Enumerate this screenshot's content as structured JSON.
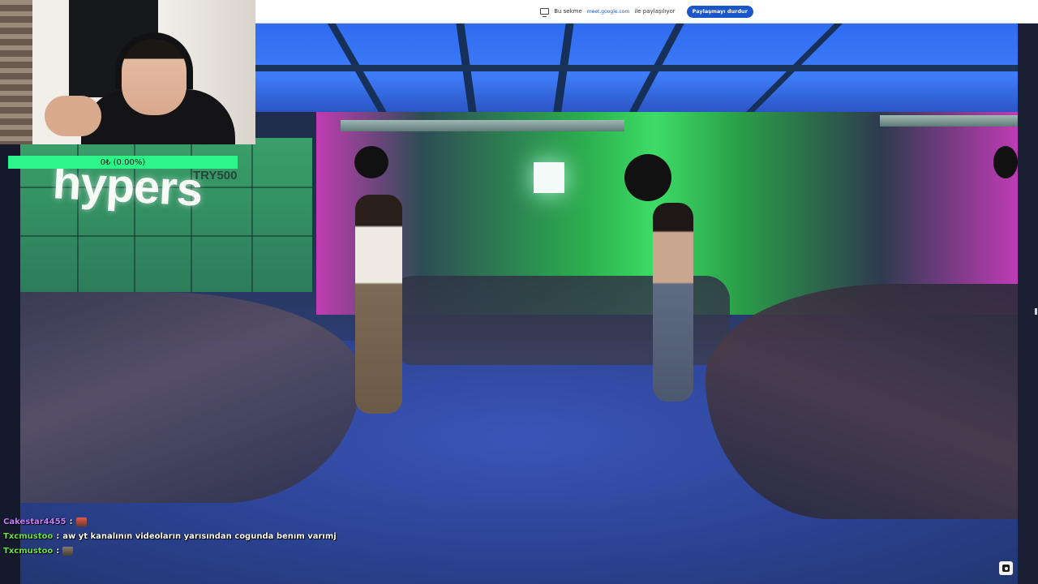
{
  "share_bar": {
    "prefix": "Bu sekme",
    "domain": "meet.google.com",
    "suffix": "ile paylaşılıyor",
    "stop_button": "Paylaşmayı durdur"
  },
  "overlay": {
    "goal_text": "0₺ (0.00%)",
    "brand_sign": "hypers",
    "sign_label": "TRY500"
  },
  "chat": {
    "messages": [
      {
        "user": "Cakestar4455",
        "separator": ":",
        "text": "",
        "emote": "emote"
      },
      {
        "user": "Txcmustoo",
        "separator": ":",
        "text": "aw yt kanalının videoların yarısından cogunda benım varımj",
        "emote": ""
      },
      {
        "user": "Txcmustoo",
        "separator": ":",
        "text": "",
        "emote": "emote"
      }
    ],
    "colors": {
      "user_1": "#c77dff",
      "user_2": "#68e34a"
    }
  },
  "icons": {
    "share": "screen-share-icon",
    "corner": "camera-toggle-icon"
  }
}
